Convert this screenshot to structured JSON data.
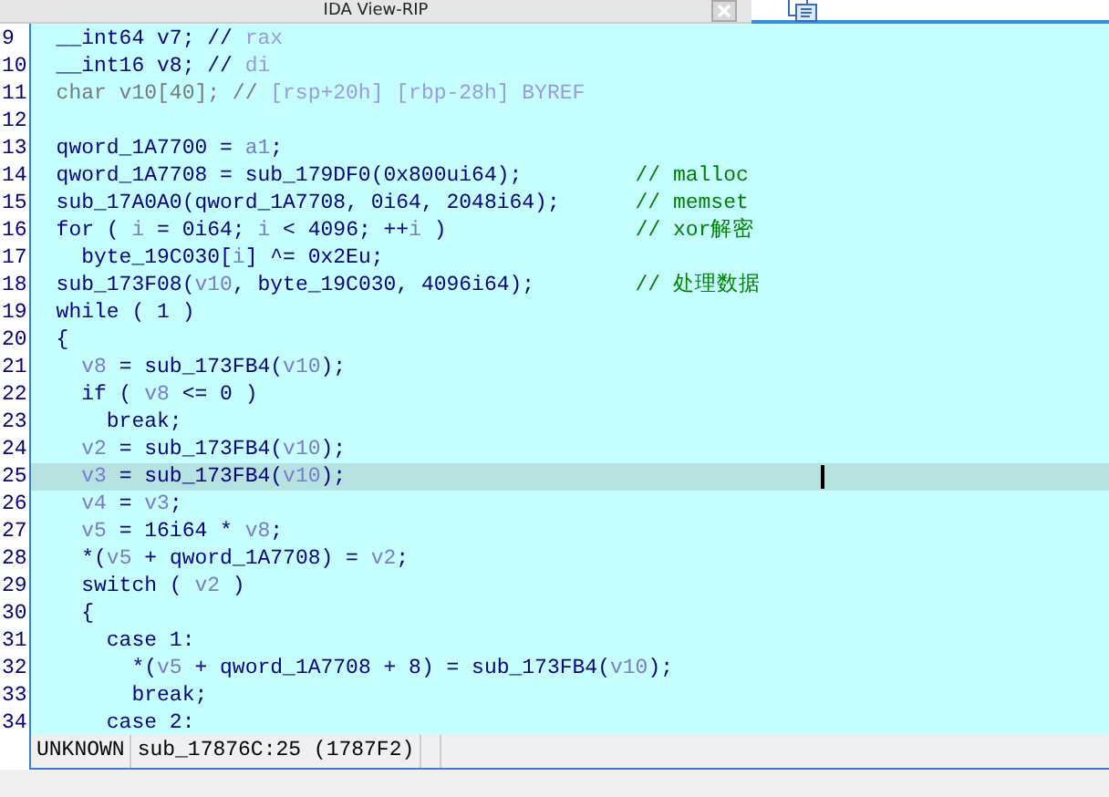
{
  "tab": {
    "title": "IDA View-RIP"
  },
  "lines": [
    {
      "number": "9",
      "current": false,
      "segments": [
        {
          "kind": "code",
          "text": "  __int64 v7; // "
        },
        {
          "kind": "note",
          "text": "rax"
        }
      ]
    },
    {
      "number": "10",
      "current": false,
      "segments": [
        {
          "kind": "code",
          "text": "  __int16 v8; // "
        },
        {
          "kind": "note",
          "text": "di"
        }
      ]
    },
    {
      "number": "11",
      "current": false,
      "segments": [
        {
          "kind": "dim",
          "text": "  char v10[40]; // "
        },
        {
          "kind": "note",
          "text": "[rsp+20h] [rbp-28h] BYREF"
        }
      ]
    },
    {
      "number": "12",
      "current": false
    },
    {
      "number": "13",
      "current": false,
      "segments": [
        {
          "kind": "code",
          "text": "  qword_1A7700 = "
        },
        {
          "kind": "var",
          "text": "a1"
        },
        {
          "kind": "code",
          "text": ";"
        }
      ]
    },
    {
      "number": "14",
      "current": false,
      "segments": [
        {
          "kind": "code",
          "text": "  qword_1A7708 = sub_179DF0(0x800ui64);         "
        },
        {
          "kind": "comment",
          "text": "// malloc"
        }
      ]
    },
    {
      "number": "15",
      "current": false,
      "segments": [
        {
          "kind": "code",
          "text": "  sub_17A0A0(qword_1A7708, 0i64, 2048i64);      "
        },
        {
          "kind": "comment",
          "text": "// memset"
        }
      ]
    },
    {
      "number": "16",
      "current": false,
      "segments": [
        {
          "kind": "code",
          "text": "  for ( "
        },
        {
          "kind": "var",
          "text": "i"
        },
        {
          "kind": "code",
          "text": " = 0i64; "
        },
        {
          "kind": "var",
          "text": "i"
        },
        {
          "kind": "code",
          "text": " < 4096; ++"
        },
        {
          "kind": "var",
          "text": "i"
        },
        {
          "kind": "code",
          "text": " )               "
        },
        {
          "kind": "comment",
          "text": "// xor解密"
        }
      ]
    },
    {
      "number": "17",
      "current": false,
      "segments": [
        {
          "kind": "code",
          "text": "    byte_19C030["
        },
        {
          "kind": "var",
          "text": "i"
        },
        {
          "kind": "code",
          "text": "] ^= 0x2Eu;"
        }
      ]
    },
    {
      "number": "18",
      "current": false,
      "segments": [
        {
          "kind": "code",
          "text": "  sub_173F08("
        },
        {
          "kind": "var",
          "text": "v10"
        },
        {
          "kind": "code",
          "text": ", byte_19C030, 4096i64);        "
        },
        {
          "kind": "comment",
          "text": "// 处理数据"
        }
      ]
    },
    {
      "number": "19",
      "current": false,
      "segments": [
        {
          "kind": "code",
          "text": "  while ( 1 )"
        }
      ]
    },
    {
      "number": "20",
      "current": false,
      "segments": [
        {
          "kind": "code",
          "text": "  {"
        }
      ]
    },
    {
      "number": "21",
      "current": false,
      "segments": [
        {
          "kind": "var",
          "text": "    v8"
        },
        {
          "kind": "code",
          "text": " = sub_173FB4("
        },
        {
          "kind": "var",
          "text": "v10"
        },
        {
          "kind": "code",
          "text": ");"
        }
      ]
    },
    {
      "number": "22",
      "current": false,
      "segments": [
        {
          "kind": "code",
          "text": "    if ( "
        },
        {
          "kind": "var",
          "text": "v8"
        },
        {
          "kind": "code",
          "text": " <= 0 )"
        }
      ]
    },
    {
      "number": "23",
      "current": false,
      "segments": [
        {
          "kind": "code",
          "text": "      break;"
        }
      ]
    },
    {
      "number": "24",
      "current": false,
      "segments": [
        {
          "kind": "var",
          "text": "    v2"
        },
        {
          "kind": "code",
          "text": " = sub_173FB4("
        },
        {
          "kind": "var",
          "text": "v10"
        },
        {
          "kind": "code",
          "text": ");"
        }
      ]
    },
    {
      "number": "25",
      "current": true,
      "segments": [
        {
          "kind": "var",
          "text": "    v3"
        },
        {
          "kind": "code",
          "text": " = sub_173FB4("
        },
        {
          "kind": "var",
          "text": "v10"
        },
        {
          "kind": "code",
          "text": ");"
        }
      ]
    },
    {
      "number": "26",
      "current": false,
      "segments": [
        {
          "kind": "var",
          "text": "    v4"
        },
        {
          "kind": "code",
          "text": " = "
        },
        {
          "kind": "var",
          "text": "v3"
        },
        {
          "kind": "code",
          "text": ";"
        }
      ]
    },
    {
      "number": "27",
      "current": false,
      "segments": [
        {
          "kind": "var",
          "text": "    v5"
        },
        {
          "kind": "code",
          "text": " = 16i64 * "
        },
        {
          "kind": "var",
          "text": "v8"
        },
        {
          "kind": "code",
          "text": ";"
        }
      ]
    },
    {
      "number": "28",
      "current": false,
      "segments": [
        {
          "kind": "code",
          "text": "    *("
        },
        {
          "kind": "var",
          "text": "v5"
        },
        {
          "kind": "code",
          "text": " + qword_1A7708) = "
        },
        {
          "kind": "var",
          "text": "v2"
        },
        {
          "kind": "code",
          "text": ";"
        }
      ]
    },
    {
      "number": "29",
      "current": false,
      "segments": [
        {
          "kind": "code",
          "text": "    switch ( "
        },
        {
          "kind": "var",
          "text": "v2"
        },
        {
          "kind": "code",
          "text": " )"
        }
      ]
    },
    {
      "number": "30",
      "current": false,
      "segments": [
        {
          "kind": "code",
          "text": "    {"
        }
      ]
    },
    {
      "number": "31",
      "current": false,
      "segments": [
        {
          "kind": "code",
          "text": "      case 1:"
        }
      ]
    },
    {
      "number": "32",
      "current": false,
      "segments": [
        {
          "kind": "code",
          "text": "        *("
        },
        {
          "kind": "var",
          "text": "v5"
        },
        {
          "kind": "code",
          "text": " + qword_1A7708 + 8) = sub_173FB4("
        },
        {
          "kind": "var",
          "text": "v10"
        },
        {
          "kind": "code",
          "text": ");"
        }
      ]
    },
    {
      "number": "33",
      "current": false,
      "segments": [
        {
          "kind": "code",
          "text": "        break;"
        }
      ]
    },
    {
      "number": "34",
      "current": false,
      "segments": [
        {
          "kind": "code",
          "text": "      case 2:"
        }
      ]
    }
  ],
  "status_bar": {
    "state": "UNKNOWN",
    "location": "sub_17876C:25 (1787F2)"
  }
}
